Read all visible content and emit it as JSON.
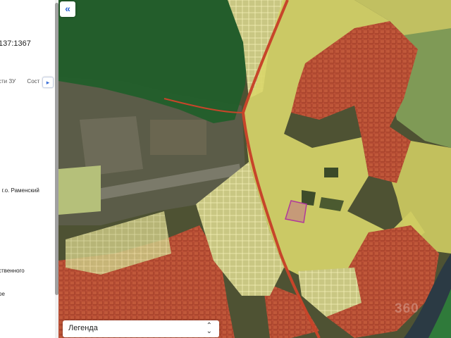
{
  "panel": {
    "cadastral_number": "137:1367",
    "tabs": [
      "сти ЗУ",
      "Сост"
    ],
    "tab_next_icon": "chevron-right-icon",
    "address_fragment": ", г.о. Раменский",
    "category_fragment": "ственного",
    "use_fragment": "ое"
  },
  "map": {
    "collapse_icon": "double-chevron-left-icon",
    "watermark": "360",
    "colors": {
      "forest": "#1f5e2a",
      "field_yellow": "#d9d66a",
      "residential_red": "#b44a2f",
      "road_red": "#c7452a",
      "selected_outline": "#b03a9a",
      "water": "#2b3a44"
    }
  },
  "legend": {
    "label": "Легенда",
    "caret_icon": "up-down-chevron-icon"
  }
}
